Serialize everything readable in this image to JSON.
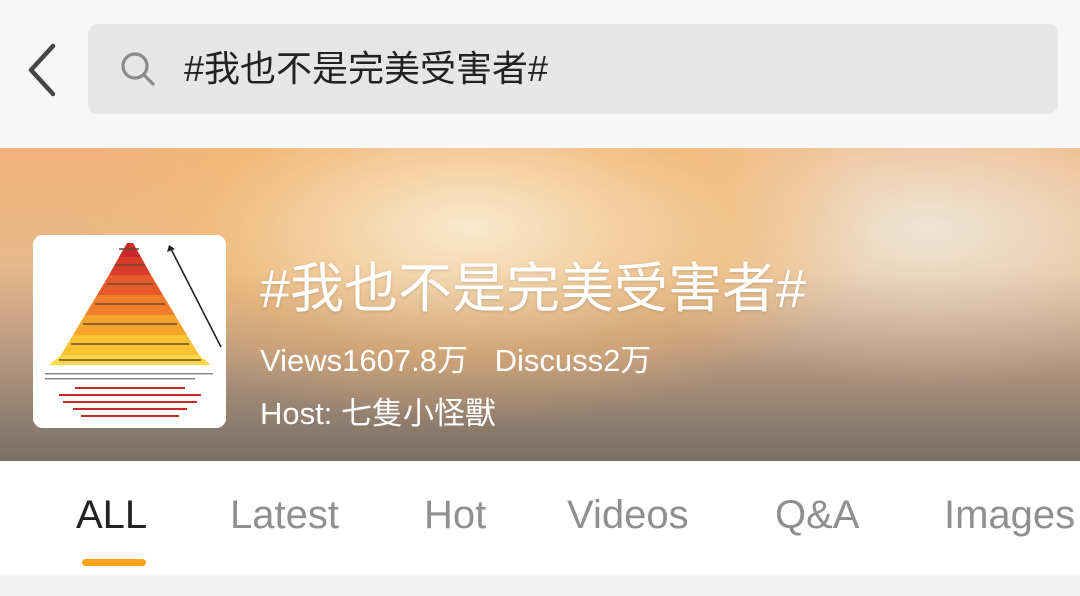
{
  "search": {
    "query": "#我也不是完美受害者#"
  },
  "topic": {
    "title": "#我也不是完美受害者#",
    "views_label": "Views1607.8万",
    "discuss_label": "Discuss2万",
    "host_label": "Host: 七隻小怪獸"
  },
  "tabs": [
    {
      "label": "ALL"
    },
    {
      "label": "Latest"
    },
    {
      "label": "Hot"
    },
    {
      "label": "Videos"
    },
    {
      "label": "Q&A"
    },
    {
      "label": "Images"
    }
  ],
  "active_tab": "ALL",
  "colors": {
    "accent": "#f6a21c",
    "search_bg": "#e6e6e6",
    "tab_inactive": "#8f8f8f",
    "tab_active": "#222222"
  },
  "icons": {
    "back": "chevron-left-icon",
    "search": "search-icon"
  }
}
